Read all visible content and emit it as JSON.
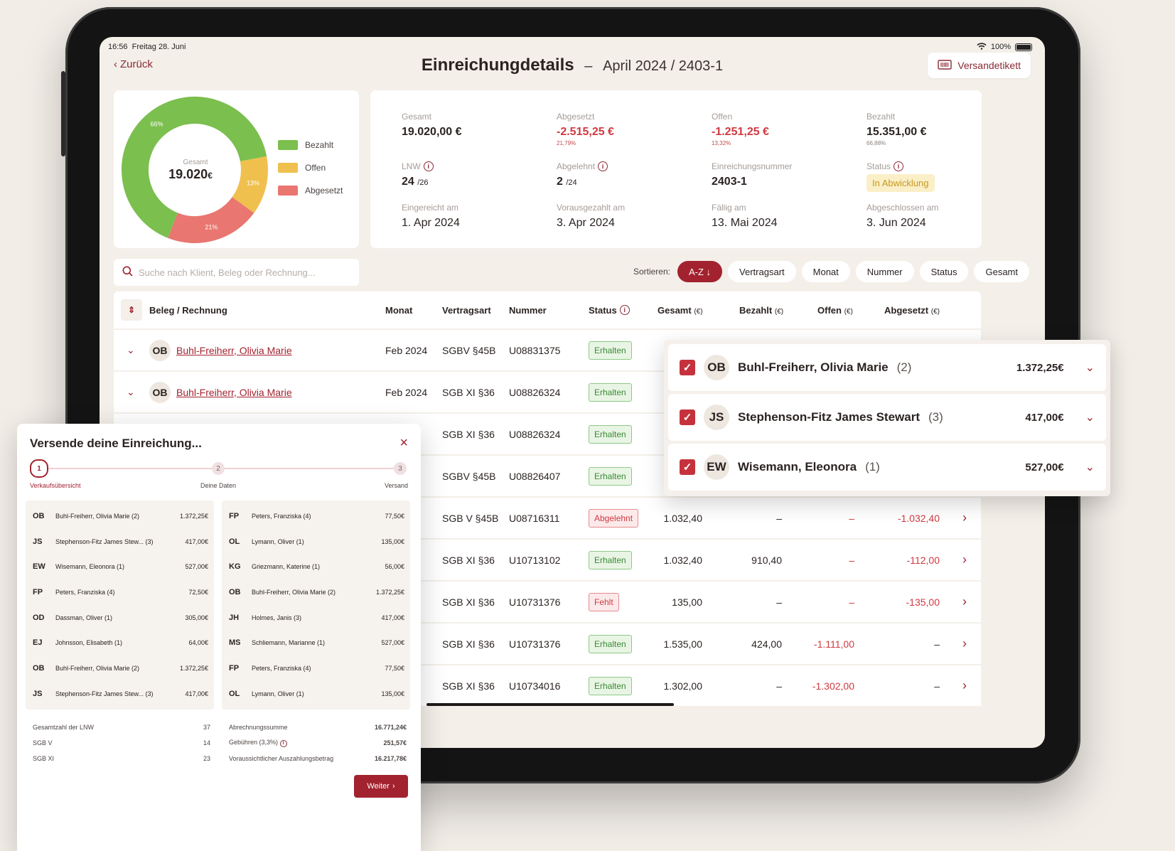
{
  "status_bar": {
    "time": "16:56",
    "date": "Freitag 28. Juni",
    "battery": "100%"
  },
  "header": {
    "back": "Zurück",
    "title": "Einreichungdetails",
    "dash": "–",
    "subtitle": "April 2024 / 2403-1",
    "label_button": "Versandetikett"
  },
  "donut": {
    "center_label": "Gesamt",
    "center_value": "19.020",
    "center_unit": "€",
    "segments": [
      {
        "label": "Bezahlt",
        "pct": "66%",
        "value": 66,
        "color": "#7bbf4f"
      },
      {
        "label": "Offen",
        "pct": "13%",
        "value": 13,
        "color": "#f0c04e"
      },
      {
        "label": "Abgesetzt",
        "pct": "21%",
        "value": 21,
        "color": "#e97670"
      }
    ]
  },
  "stats": {
    "gesamt_label": "Gesamt",
    "gesamt_value": "19.020,00 €",
    "abgesetzt_label": "Abgesetzt",
    "abgesetzt_value": "-2.515,25 €",
    "abgesetzt_pct": "21,79%",
    "offen_label": "Offen",
    "offen_value": "-1.251,25 €",
    "offen_pct": "13,32%",
    "bezahlt_label": "Bezahlt",
    "bezahlt_value": "15.351,00 €",
    "bezahlt_pct": "66,88%",
    "lnw_label": "LNW",
    "lnw_value": "24",
    "lnw_of": "/26",
    "abgelehnt_label": "Abgelehnt",
    "abgelehnt_value": "2",
    "abgelehnt_of": "/24",
    "nummer_label": "Einreichungsnummer",
    "nummer_value": "2403-1",
    "status_label": "Status",
    "status_value": "In Abwicklung",
    "eingereicht_label": "Eingereicht am",
    "eingereicht_value": "1. Apr 2024",
    "vorausgezahlt_label": "Vorausgezahlt am",
    "vorausgezahlt_value": "3. Apr 2024",
    "faellig_label": "Fällig am",
    "faellig_value": "13. Mai 2024",
    "abgeschlossen_label": "Abgeschlossen am",
    "abgeschlossen_value": "3. Jun  2024"
  },
  "search": {
    "placeholder": "Suche nach Klient, Beleg oder Rechnung..."
  },
  "sort": {
    "label": "Sortieren:",
    "active": "A-Z ↓",
    "options": [
      "Vertragsart",
      "Monat",
      "Nummer",
      "Status",
      "Gesamt"
    ]
  },
  "table": {
    "headers": {
      "beleg": "Beleg / Rechnung",
      "monat": "Monat",
      "vertragsart": "Vertragsart",
      "nummer": "Nummer",
      "status": "Status",
      "gesamt": "Gesamt",
      "bezahlt": "Bezahlt",
      "offen": "Offen",
      "abgesetzt": "Abgesetzt",
      "unit": "(€)"
    },
    "rows": [
      {
        "initials": "OB",
        "name": "Buhl-Freiherr, Olivia Marie",
        "monat": "Feb 2024",
        "vertragsart": "SGBV §45B",
        "nummer": "U08831375",
        "status": "Erhalten",
        "gesamt": "",
        "bezahlt": "",
        "offen": "",
        "abgesetzt": ""
      },
      {
        "initials": "OB",
        "name": "Buhl-Freiherr, Olivia Marie",
        "monat": "Feb 2024",
        "vertragsart": "SGB XI §36",
        "nummer": "U08826324",
        "status": "Erhalten",
        "gesamt": "",
        "bezahlt": "",
        "offen": "",
        "abgesetzt": ""
      },
      {
        "initials": "",
        "name": "",
        "monat": "",
        "vertragsart": "SGB XI §36",
        "nummer": "U08826324",
        "status": "Erhalten",
        "gesamt": "",
        "bezahlt": "",
        "offen": "",
        "abgesetzt": ""
      },
      {
        "initials": "",
        "name": "",
        "monat": "",
        "vertragsart": "SGBV §45B",
        "nummer": "U08826407",
        "status": "Erhalten",
        "gesamt": "",
        "bezahlt": "",
        "offen": "",
        "abgesetzt": ""
      },
      {
        "initials": "",
        "name": "",
        "monat": "",
        "vertragsart": "SGB V §45B",
        "nummer": "U08716311",
        "status": "Abgelehnt",
        "gesamt": "1.032,40",
        "bezahlt": "–",
        "offen": "–",
        "abgesetzt": "-1.032,40"
      },
      {
        "initials": "",
        "name": "",
        "monat": "",
        "vertragsart": "SGB XI §36",
        "nummer": "U10713102",
        "status": "Erhalten",
        "gesamt": "1.032,40",
        "bezahlt": "910,40",
        "offen": "–",
        "abgesetzt": "-112,00"
      },
      {
        "initials": "",
        "name": "",
        "monat": "",
        "vertragsart": "SGB XI §36",
        "nummer": "U10731376",
        "status": "Fehlt",
        "gesamt": "135,00",
        "bezahlt": "–",
        "offen": "–",
        "abgesetzt": "-135,00"
      },
      {
        "initials": "",
        "name": "",
        "monat": "",
        "vertragsart": "SGB XI §36",
        "nummer": "U10731376",
        "status": "Erhalten",
        "gesamt": "1.535,00",
        "bezahlt": "424,00",
        "offen": "-1.111,00",
        "abgesetzt": "–"
      },
      {
        "initials": "",
        "name": "",
        "monat": "",
        "vertragsart": "SGB XI §36",
        "nummer": "U10734016",
        "status": "Erhalten",
        "gesamt": "1.302,00",
        "bezahlt": "–",
        "offen": "-1.302,00",
        "abgesetzt": "–"
      }
    ]
  },
  "popover": {
    "items": [
      {
        "initials": "OB",
        "name": "Buhl-Freiherr, Olivia Marie",
        "count": "(2)",
        "amount": "1.372,25€"
      },
      {
        "initials": "JS",
        "name": "Stephenson-Fitz James Stewart",
        "count": "(3)",
        "amount": "417,00€"
      },
      {
        "initials": "EW",
        "name": "Wisemann, Eleonora",
        "count": "(1)",
        "amount": "527,00€"
      }
    ]
  },
  "modal": {
    "title": "Versende deine Einreichung...",
    "steps": [
      {
        "num": "1",
        "label": "Verkaufsübersicht"
      },
      {
        "num": "2",
        "label": "Deine Daten"
      },
      {
        "num": "3",
        "label": "Versand"
      }
    ],
    "left_list": [
      {
        "i": "OB",
        "n": "Buhl-Freiherr, Olivia Marie (2)",
        "a": "1.372,25€"
      },
      {
        "i": "JS",
        "n": "Stephenson-Fitz James Stew... (3)",
        "a": "417,00€"
      },
      {
        "i": "EW",
        "n": "Wisemann, Eleonora (1)",
        "a": "527,00€"
      },
      {
        "i": "FP",
        "n": "Peters, Franziska (4)",
        "a": "72,50€"
      },
      {
        "i": "OD",
        "n": "Dassman, Oliver (1)",
        "a": "305,00€"
      },
      {
        "i": "EJ",
        "n": "Johnsson, Elisabeth (1)",
        "a": "64,00€"
      },
      {
        "i": "OB",
        "n": "Buhl-Freiherr, Olivia Marie (2)",
        "a": "1.372,25€"
      },
      {
        "i": "JS",
        "n": "Stephenson-Fitz James Stew... (3)",
        "a": "417,00€"
      }
    ],
    "right_list": [
      {
        "i": "FP",
        "n": "Peters, Franziska (4)",
        "a": "77,50€"
      },
      {
        "i": "OL",
        "n": "Lymann, Oliver (1)",
        "a": "135,00€"
      },
      {
        "i": "KG",
        "n": "Griezmann, Katerine (1)",
        "a": "56,00€"
      },
      {
        "i": "OB",
        "n": "Buhl-Freiherr, Olivia Marie (2)",
        "a": "1.372,25€"
      },
      {
        "i": "JH",
        "n": "Holmes, Janis (3)",
        "a": "417,00€"
      },
      {
        "i": "MS",
        "n": "Schliemann, Marianne (1)",
        "a": "527,00€"
      },
      {
        "i": "FP",
        "n": "Peters, Franziska (4)",
        "a": "77,50€"
      },
      {
        "i": "OL",
        "n": "Lymann, Oliver (1)",
        "a": "135,00€"
      }
    ],
    "summary_left": [
      {
        "k": "Gesamtzahl der LNW",
        "v": "37"
      },
      {
        "k": "SGB V",
        "v": "14"
      },
      {
        "k": "SGB XI",
        "v": "23"
      }
    ],
    "summary_right": [
      {
        "k": "Abrechnungssumme",
        "v": "16.771,24€"
      },
      {
        "k": "Gebühren (3,3%)",
        "v": "251,57€"
      },
      {
        "k": "Voraussichtlicher Auszahlungsbetrag",
        "v": "16.217,78€"
      }
    ],
    "next": "Weiter"
  }
}
